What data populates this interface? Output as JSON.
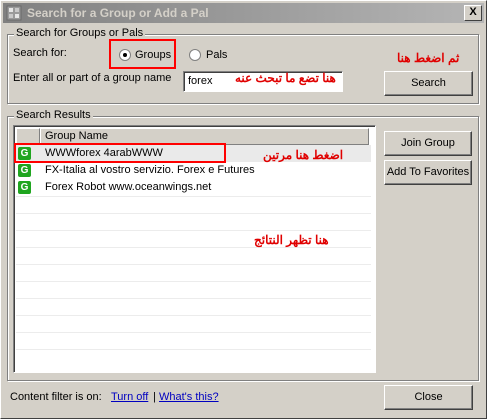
{
  "window": {
    "title": "Search for a Group or Add a Pal",
    "close_glyph": "X"
  },
  "search_section": {
    "legend": "Search for Groups or Pals",
    "search_for_label": "Search for:",
    "radio_groups": "Groups",
    "radio_pals": "Pals",
    "selected": "Groups",
    "name_label": "Enter all or part of a group name",
    "input_value": "forex",
    "search_button": "Search"
  },
  "results_section": {
    "legend": "Search Results",
    "column_header": "Group Name",
    "rows": [
      {
        "icon": "G",
        "name": "WWWforex 4arabWWW"
      },
      {
        "icon": "G",
        "name": "FX-Italia al vostro servizio. Forex e Futures"
      },
      {
        "icon": "G",
        "name": "Forex Robot www.oceanwings.net"
      }
    ],
    "join_button": "Join Group",
    "favorites_button": "Add To Favorites"
  },
  "footer": {
    "filter_text": "Content filter is on:",
    "turn_off": "Turn off",
    "separator": "|",
    "whats_this": "What's this?",
    "close_button": "Close"
  },
  "annotations": {
    "then_click_here": "ثم اضغط هنا",
    "type_search_here": "هنا تضع ما تبحث عنه",
    "double_click_here": "اضغط هنا مرتين",
    "results_appear_here": "هنا تظهر النتائج"
  },
  "colors": {
    "annotation": "#e00000",
    "group_icon": "#1fa51f",
    "link": "#0000c0"
  }
}
